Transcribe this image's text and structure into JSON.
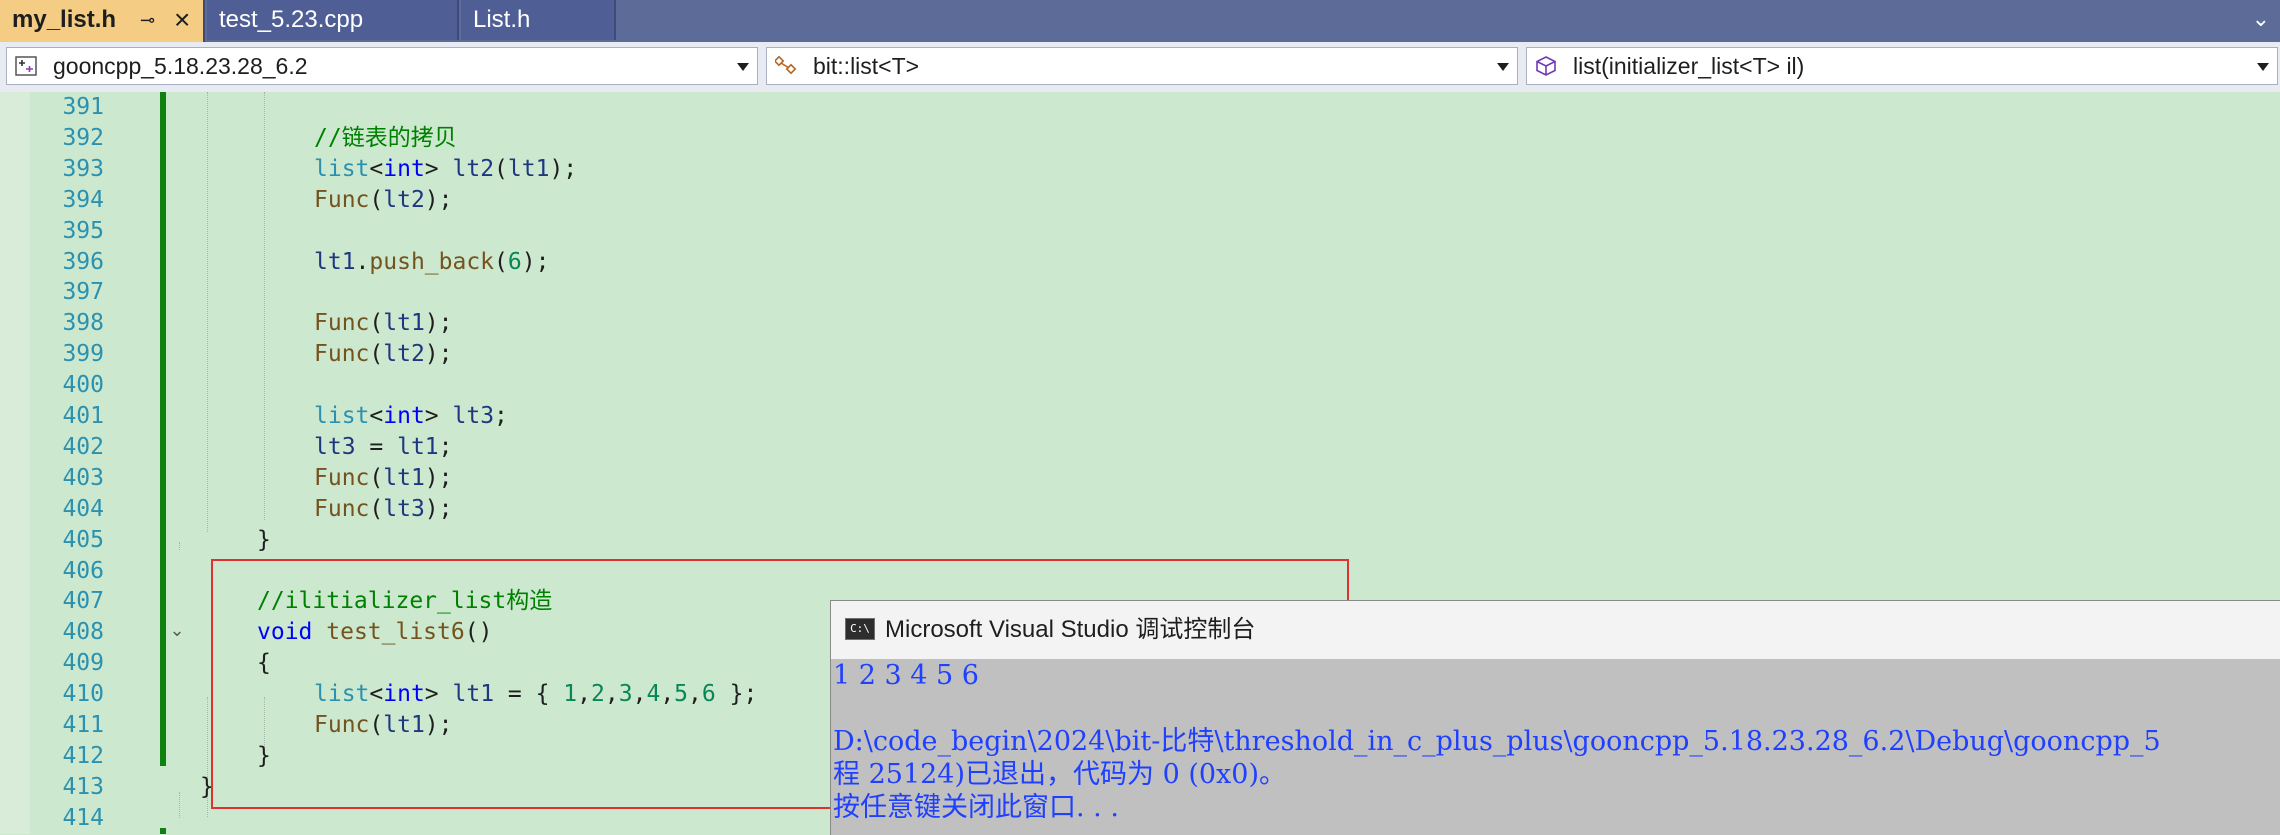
{
  "tabs": [
    {
      "label": "my_list.h",
      "pin": "⊸",
      "close": "×"
    },
    {
      "label": "test_5.23.cpp"
    },
    {
      "label": "List.h"
    }
  ],
  "tab_overflow_icon": "chevron-down-icon",
  "nav": {
    "project": "gooncpp_5.18.23.28_6.2",
    "scope": "bit::list<T>",
    "member": "list(initializer_list<T> il)"
  },
  "editor": {
    "lines": [
      {
        "n": "391",
        "indent": 2,
        "tokens": []
      },
      {
        "n": "392",
        "indent": 2,
        "tokens": [
          {
            "t": "//链表的拷贝",
            "c": "comment"
          }
        ]
      },
      {
        "n": "393",
        "indent": 2,
        "tokens": [
          {
            "t": "list",
            "c": "type"
          },
          {
            "t": "<",
            "c": "plain"
          },
          {
            "t": "int",
            "c": "kw"
          },
          {
            "t": "> ",
            "c": "plain"
          },
          {
            "t": "lt2",
            "c": "var"
          },
          {
            "t": "(",
            "c": "plain"
          },
          {
            "t": "lt1",
            "c": "var"
          },
          {
            "t": ");",
            "c": "plain"
          }
        ]
      },
      {
        "n": "394",
        "indent": 2,
        "tokens": [
          {
            "t": "Func",
            "c": "func"
          },
          {
            "t": "(",
            "c": "plain"
          },
          {
            "t": "lt2",
            "c": "var"
          },
          {
            "t": ");",
            "c": "plain"
          }
        ]
      },
      {
        "n": "395",
        "indent": 2,
        "tokens": []
      },
      {
        "n": "396",
        "indent": 2,
        "tokens": [
          {
            "t": "lt1",
            "c": "var"
          },
          {
            "t": ".",
            "c": "plain"
          },
          {
            "t": "push_back",
            "c": "func"
          },
          {
            "t": "(",
            "c": "plain"
          },
          {
            "t": "6",
            "c": "num"
          },
          {
            "t": ");",
            "c": "plain"
          }
        ]
      },
      {
        "n": "397",
        "indent": 2,
        "tokens": []
      },
      {
        "n": "398",
        "indent": 2,
        "tokens": [
          {
            "t": "Func",
            "c": "func"
          },
          {
            "t": "(",
            "c": "plain"
          },
          {
            "t": "lt1",
            "c": "var"
          },
          {
            "t": ");",
            "c": "plain"
          }
        ]
      },
      {
        "n": "399",
        "indent": 2,
        "tokens": [
          {
            "t": "Func",
            "c": "func"
          },
          {
            "t": "(",
            "c": "plain"
          },
          {
            "t": "lt2",
            "c": "var"
          },
          {
            "t": ");",
            "c": "plain"
          }
        ]
      },
      {
        "n": "400",
        "indent": 2,
        "tokens": []
      },
      {
        "n": "401",
        "indent": 2,
        "tokens": [
          {
            "t": "list",
            "c": "type"
          },
          {
            "t": "<",
            "c": "plain"
          },
          {
            "t": "int",
            "c": "kw"
          },
          {
            "t": "> ",
            "c": "plain"
          },
          {
            "t": "lt3",
            "c": "var"
          },
          {
            "t": ";",
            "c": "plain"
          }
        ]
      },
      {
        "n": "402",
        "indent": 2,
        "tokens": [
          {
            "t": "lt3",
            "c": "var"
          },
          {
            "t": " = ",
            "c": "plain"
          },
          {
            "t": "lt1",
            "c": "var"
          },
          {
            "t": ";",
            "c": "plain"
          }
        ]
      },
      {
        "n": "403",
        "indent": 2,
        "tokens": [
          {
            "t": "Func",
            "c": "func"
          },
          {
            "t": "(",
            "c": "plain"
          },
          {
            "t": "lt1",
            "c": "var"
          },
          {
            "t": ");",
            "c": "plain"
          }
        ]
      },
      {
        "n": "404",
        "indent": 2,
        "tokens": [
          {
            "t": "Func",
            "c": "func"
          },
          {
            "t": "(",
            "c": "plain"
          },
          {
            "t": "lt3",
            "c": "var"
          },
          {
            "t": ");",
            "c": "plain"
          }
        ]
      },
      {
        "n": "405",
        "indent": 1,
        "tokens": [
          {
            "t": "}",
            "c": "plain"
          }
        ]
      },
      {
        "n": "406",
        "indent": 1,
        "tokens": []
      },
      {
        "n": "407",
        "indent": 1,
        "tokens": [
          {
            "t": "//ilitializer_list构造",
            "c": "comment"
          }
        ]
      },
      {
        "n": "408",
        "indent": 1,
        "fold": "⌄",
        "tokens": [
          {
            "t": "void",
            "c": "kw"
          },
          {
            "t": " ",
            "c": "plain"
          },
          {
            "t": "test_list6",
            "c": "func"
          },
          {
            "t": "()",
            "c": "plain"
          }
        ]
      },
      {
        "n": "409",
        "indent": 1,
        "tokens": [
          {
            "t": "{",
            "c": "plain"
          }
        ]
      },
      {
        "n": "410",
        "indent": 2,
        "tokens": [
          {
            "t": "list",
            "c": "type"
          },
          {
            "t": "<",
            "c": "plain"
          },
          {
            "t": "int",
            "c": "kw"
          },
          {
            "t": "> ",
            "c": "plain"
          },
          {
            "t": "lt1",
            "c": "var"
          },
          {
            "t": " = { ",
            "c": "plain"
          },
          {
            "t": "1",
            "c": "num"
          },
          {
            "t": ",",
            "c": "plain"
          },
          {
            "t": "2",
            "c": "num"
          },
          {
            "t": ",",
            "c": "plain"
          },
          {
            "t": "3",
            "c": "num"
          },
          {
            "t": ",",
            "c": "plain"
          },
          {
            "t": "4",
            "c": "num"
          },
          {
            "t": ",",
            "c": "plain"
          },
          {
            "t": "5",
            "c": "num"
          },
          {
            "t": ",",
            "c": "plain"
          },
          {
            "t": "6",
            "c": "num"
          },
          {
            "t": " };",
            "c": "plain"
          }
        ]
      },
      {
        "n": "411",
        "indent": 2,
        "tokens": [
          {
            "t": "Func",
            "c": "func"
          },
          {
            "t": "(",
            "c": "plain"
          },
          {
            "t": "lt1",
            "c": "var"
          },
          {
            "t": ");",
            "c": "plain"
          }
        ]
      },
      {
        "n": "412",
        "indent": 1,
        "tokens": [
          {
            "t": "}",
            "c": "plain"
          }
        ]
      },
      {
        "n": "413",
        "indent": 0,
        "tokens": [
          {
            "t": "}",
            "c": "plain"
          }
        ]
      },
      {
        "n": "414",
        "indent": 0,
        "tokens": []
      }
    ]
  },
  "console": {
    "title": "Microsoft Visual Studio 调试控制台",
    "icon_text": "C:\\",
    "lines": [
      "1 2 3 4 5 6",
      "",
      "D:\\code_begin\\2024\\bit-比特\\threshold_in_c_plus_plus\\gooncpp_5.18.23.28_6.2\\Debug\\gooncpp_5",
      "程 25124)已退出，代码为 0 (0x0)。",
      "按任意键关闭此窗口. . ."
    ]
  },
  "colors": {
    "editor_bg": "#cce8cf",
    "tabbar_bg": "#5d6b99",
    "active_tab": "#f5cc84",
    "annotation_red": "#e03030",
    "console_text": "#2040ff"
  }
}
